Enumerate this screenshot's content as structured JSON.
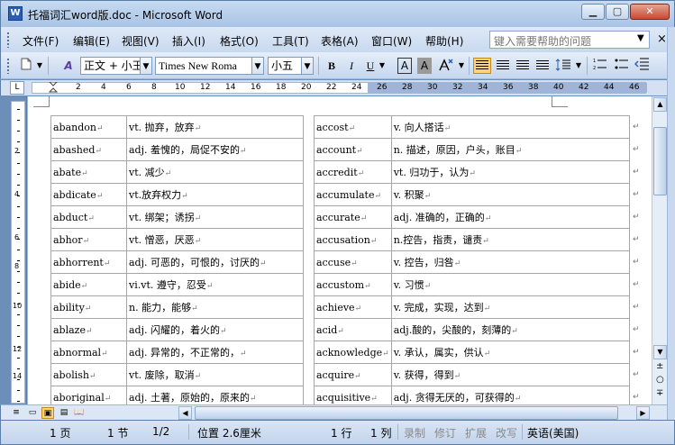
{
  "window": {
    "title": "托福词汇word版.doc - Microsoft Word",
    "icon_label": "W",
    "min_glyph": "▁",
    "max_glyph": "▢",
    "close_glyph": "✕"
  },
  "menubar": {
    "items": [
      "文件(F)",
      "编辑(E)",
      "视图(V)",
      "插入(I)",
      "格式(O)",
      "工具(T)",
      "表格(A)",
      "窗口(W)",
      "帮助(H)"
    ],
    "help_placeholder": "键入需要帮助的问题",
    "dropdown_glyph": "▼",
    "close_glyph": "×"
  },
  "toolbar": {
    "style_value": "正文 + 小王",
    "font_value": "Times New Roma",
    "size_value": "小五",
    "bold": "B",
    "italic": "I",
    "underline": "U",
    "char_border": "A",
    "char_shading": "A",
    "style_icon_glyph": "A",
    "arrow_glyph": "▼"
  },
  "ruler": {
    "numbers": [
      "2",
      "4",
      "6",
      "8",
      "10",
      "12",
      "14",
      "16",
      "18",
      "20",
      "22",
      "24",
      "26",
      "28",
      "30",
      "32",
      "34",
      "36",
      "38",
      "40",
      "42",
      "44",
      "46"
    ],
    "corner_glyph": "L",
    "vertical_numbers": [
      "2",
      "4",
      "6",
      "8",
      "10",
      "12",
      "14"
    ]
  },
  "table": {
    "rows": [
      {
        "w1": "abandon",
        "d1": "vt. 抛弃，放弃",
        "w2": "accost",
        "d2": "v. 向人搭话"
      },
      {
        "w1": "abashed",
        "d1": "adj. 羞愧的，局促不安的",
        "w2": "account",
        "d2": "n. 描述，原因，户头，账目"
      },
      {
        "w1": "abate",
        "d1": "vt. 减少",
        "w2": "accredit",
        "d2": "vt. 归功于，认为"
      },
      {
        "w1": "abdicate",
        "d1": "vt.放弃权力",
        "w2": "accumulate",
        "d2": "v. 积聚"
      },
      {
        "w1": "abduct",
        "d1": "vt. 绑架；诱拐",
        "w2": "accurate",
        "d2": "adj. 准确的，正确的"
      },
      {
        "w1": "abhor",
        "d1": "vt. 憎恶，厌恶",
        "w2": "accusation",
        "d2": "n.控告，指责，谴责"
      },
      {
        "w1": "abhorrent",
        "d1": "adj. 可恶的，可恨的，讨厌的",
        "w2": "accuse",
        "d2": "v. 控告，归咎"
      },
      {
        "w1": "abide",
        "d1": "vi.vt. 遵守，忍受",
        "w2": "accustom",
        "d2": "v. 习惯"
      },
      {
        "w1": "ability",
        "d1": "n. 能力，能够",
        "w2": "achieve",
        "d2": "v. 完成，实现，达到"
      },
      {
        "w1": "ablaze",
        "d1": "adj. 闪耀的，着火的",
        "w2": "acid",
        "d2": "adj.酸的，尖酸的，刻薄的"
      },
      {
        "w1": "abnormal",
        "d1": "adj. 异常的，不正常的，",
        "w2": "acknowledge",
        "d2": "v. 承认，属实，供认"
      },
      {
        "w1": "abolish",
        "d1": "vt. 废除，取消",
        "w2": "acquire",
        "d2": "v. 获得，得到"
      },
      {
        "w1": "aboriginal",
        "d1": "adj. 土著，原始的，原来的",
        "w2": "acquisitive",
        "d2": "adj. 贪得无厌的，可获得的"
      }
    ],
    "cell_mark": "↵",
    "row_mark": "↵"
  },
  "viewbar": {
    "views": [
      "≡",
      "▭",
      "▣",
      "▤",
      "📖"
    ],
    "left_glyph": "◀",
    "right_glyph": "▶"
  },
  "vscroll": {
    "up_glyph": "▲",
    "down_glyph": "▼",
    "prev_glyph": "±",
    "browse_glyph": "○",
    "next_glyph": "∓"
  },
  "statusbar": {
    "page": "1 页",
    "section": "1 节",
    "page_of": "1/2",
    "position": "位置 2.6厘米",
    "line": "1 行",
    "column": "1 列",
    "rec": "录制",
    "trk": "修订",
    "ext": "扩展",
    "ovr": "改写",
    "language": "英语(美国)"
  }
}
